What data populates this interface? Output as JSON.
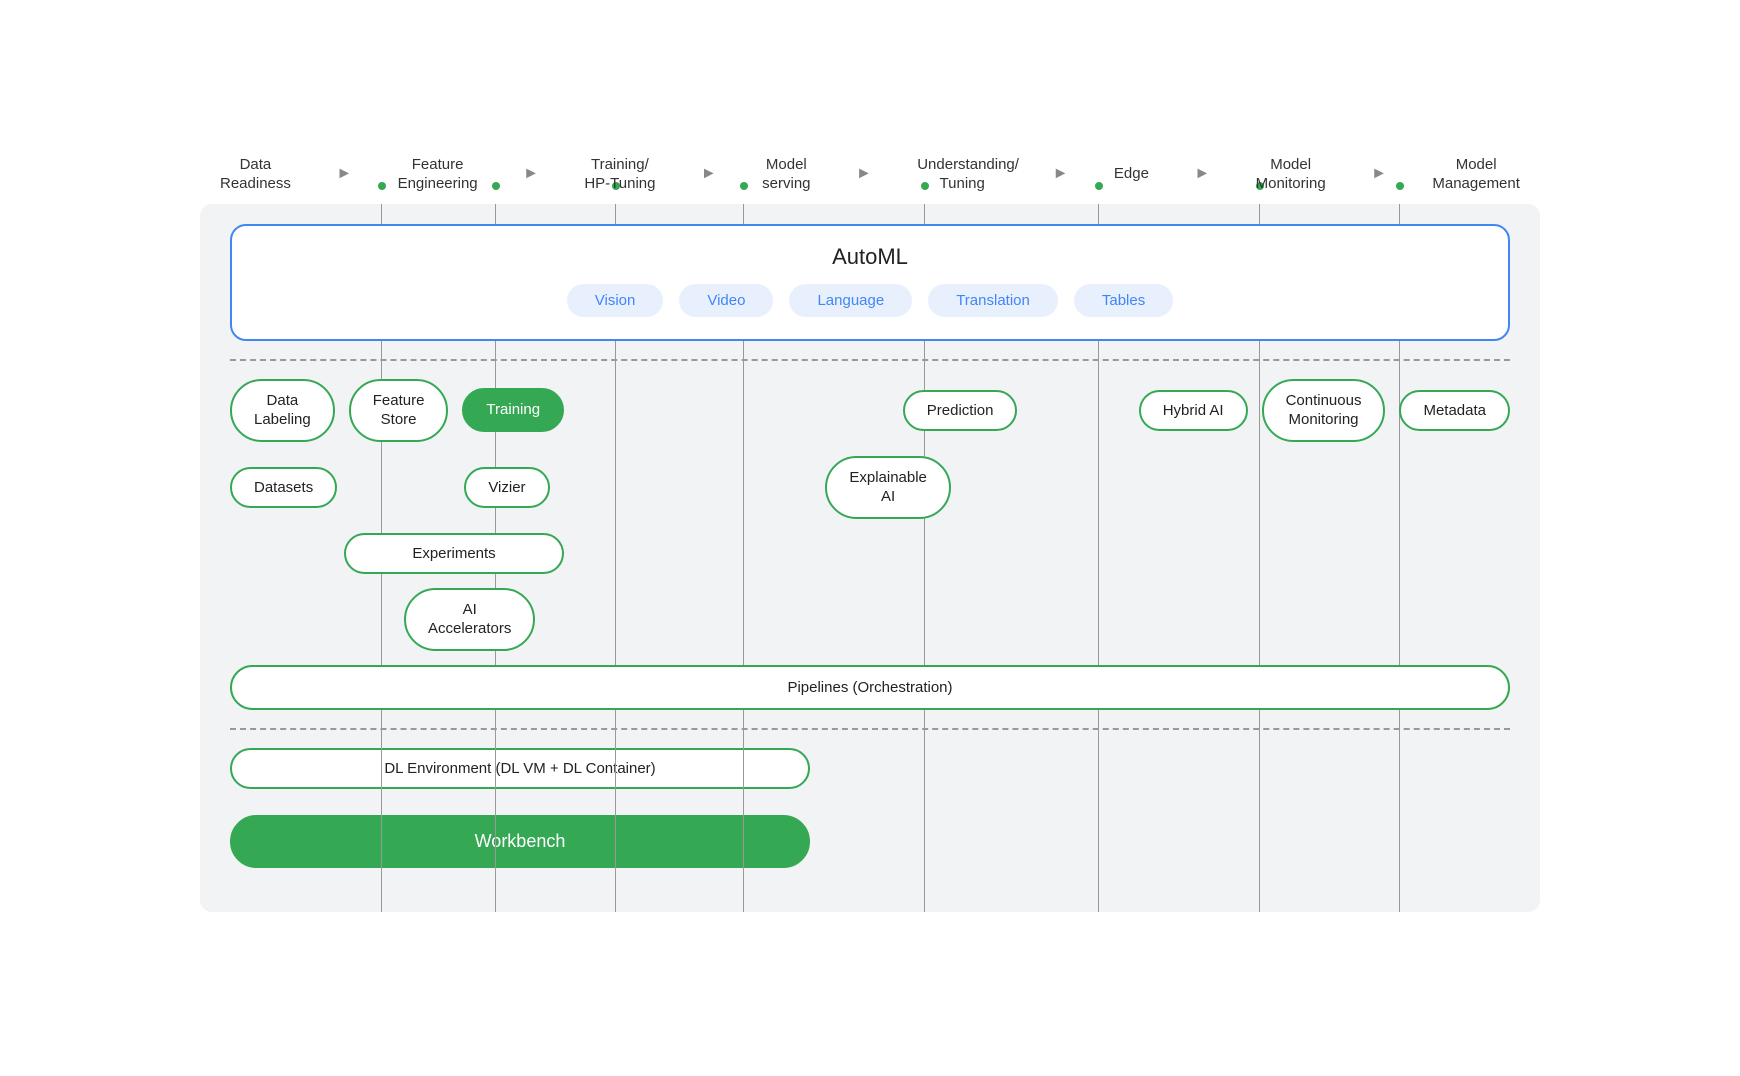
{
  "pipeline": {
    "steps": [
      {
        "label": "Data\nReadiness"
      },
      {
        "label": "Feature\nEngineering"
      },
      {
        "label": "Training/\nHP-Tuning"
      },
      {
        "label": "Model\nserving"
      },
      {
        "label": "Understanding/\nTuning"
      },
      {
        "label": "Edge"
      },
      {
        "label": "Model\nMonitoring"
      },
      {
        "label": "Model\nManagement"
      }
    ]
  },
  "automl": {
    "title": "AutoML",
    "chips": [
      "Vision",
      "Video",
      "Language",
      "Translation",
      "Tables"
    ]
  },
  "rows": {
    "row1": {
      "items": [
        "Data\nLabeling",
        "Feature\nStore",
        "Training",
        "Prediction",
        "Hybrid AI",
        "Continuous\nMonitoring",
        "Metadata"
      ]
    },
    "row2": {
      "items": [
        "Datasets",
        "Vizier",
        "Explainable\nAI"
      ]
    },
    "row3": {
      "items": [
        "Experiments"
      ]
    },
    "row4": {
      "items": [
        "AI\nAccelerators"
      ]
    },
    "pipelines": "Pipelines (Orchestration)",
    "dl_env": "DL Environment (DL VM + DL Container)",
    "workbench": "Workbench"
  },
  "vertLines": {
    "positions": [
      13.5,
      22,
      31,
      40.5,
      54,
      67,
      79,
      89.5
    ]
  }
}
